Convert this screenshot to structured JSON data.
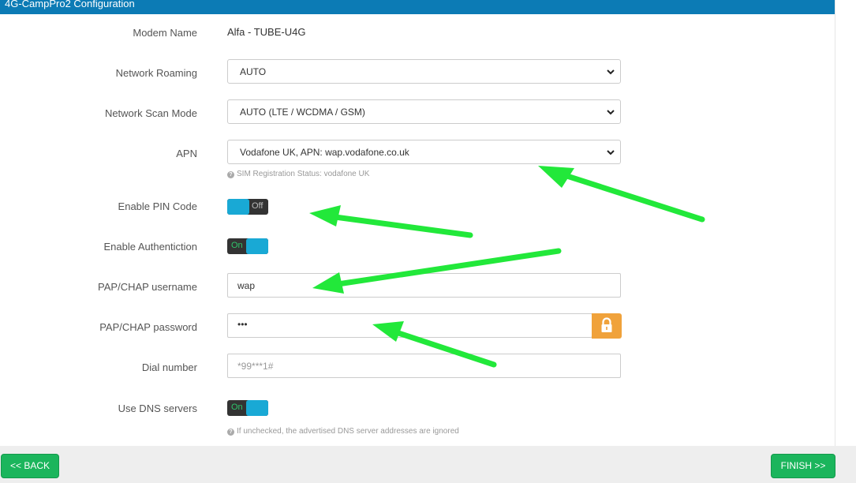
{
  "title": "4G-CampPro2 Configuration",
  "fields": {
    "modem_name": {
      "label": "Modem Name",
      "value": "Alfa - TUBE-U4G"
    },
    "network_roaming": {
      "label": "Network Roaming",
      "value": "AUTO"
    },
    "network_scan_mode": {
      "label": "Network Scan Mode",
      "value": "AUTO (LTE / WCDMA / GSM)"
    },
    "apn": {
      "label": "APN",
      "value": "Vodafone UK, APN: wap.vodafone.co.uk",
      "help": "SIM Registration Status: vodafone UK"
    },
    "enable_pin": {
      "label": "Enable PIN Code",
      "state": "Off"
    },
    "enable_auth": {
      "label": "Enable Authentiction",
      "state": "On"
    },
    "pap_username": {
      "label": "PAP/CHAP username",
      "value": "wap"
    },
    "pap_password": {
      "label": "PAP/CHAP password",
      "value": "•••"
    },
    "dial_number": {
      "label": "Dial number",
      "placeholder": "*99***1#"
    },
    "use_dns": {
      "label": "Use DNS servers",
      "state": "On",
      "help": "If unchecked, the advertised DNS server addresses are ignored"
    }
  },
  "buttons": {
    "back": "<< BACK",
    "finish": "FINISH >>"
  },
  "icons": {
    "help": "question-circle-icon",
    "lock": "lock-icon",
    "dropdown": "chevron-down-icon"
  },
  "colors": {
    "title_bar": "#0c7bb5",
    "toggle_knob": "#19a9d5",
    "button_green": "#1bb55c",
    "lock_orange": "#f0a23b",
    "annotation_arrow": "#22e83a"
  }
}
